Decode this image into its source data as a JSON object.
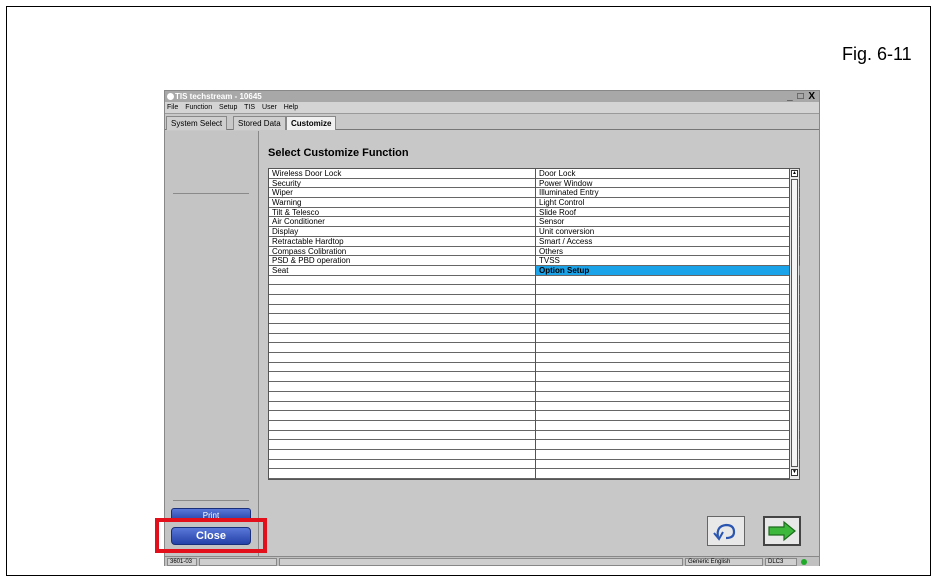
{
  "figure_label": "Fig. 6-11",
  "window": {
    "title": "TIS techstream - 10645",
    "controls": "_ □ X"
  },
  "menu": [
    "File",
    "Function",
    "Setup",
    "TIS",
    "User",
    "Help"
  ],
  "tabs": [
    {
      "label": "System Select",
      "active": false
    },
    {
      "label": "Stored Data",
      "active": false
    },
    {
      "label": "Customize",
      "active": true
    }
  ],
  "sidebar": {
    "print_label": "Print",
    "close_label": "Close"
  },
  "main": {
    "title": "Select Customize Function",
    "left_items": [
      "Wireless Door Lock",
      "Security",
      "Wiper",
      "Warning",
      "Tilt & Telesco",
      "Air Conditioner",
      "Display",
      "Retractable Hardtop",
      "Compass Colibration",
      "PSD & PBD operation",
      "Seat"
    ],
    "right_items": [
      "Door Lock",
      "Power Window",
      "Illuminated Entry",
      "Light Control",
      "Slide Roof",
      "Sensor",
      "Unit conversion",
      "Smart / Access",
      "Others",
      "TVSS",
      "Option Setup"
    ],
    "selected_item": "Option Setup",
    "empty_row_count": 21
  },
  "status": {
    "code": "3601-03",
    "language": "Generic English",
    "connection": "DLC3"
  },
  "colors": {
    "selection": "#1aa3e8",
    "button_blue": "#2442a8",
    "highlight": "#e3101b",
    "status_ok": "#1faa2a",
    "arrow_green": "#3db83d"
  }
}
